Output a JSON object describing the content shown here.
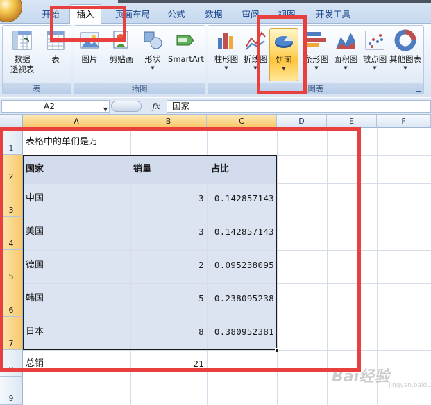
{
  "ribbon": {
    "tabs": [
      {
        "id": "home",
        "label": "开始"
      },
      {
        "id": "insert",
        "label": "插入",
        "active": true
      },
      {
        "id": "page-layout",
        "label": "页面布局"
      },
      {
        "id": "formulas",
        "label": "公式"
      },
      {
        "id": "data",
        "label": "数据"
      },
      {
        "id": "review",
        "label": "审阅"
      },
      {
        "id": "view",
        "label": "视图"
      },
      {
        "id": "developer",
        "label": "开发工具"
      }
    ],
    "groups": {
      "tables": {
        "label": "表",
        "pivot_label": "数据\n透视表",
        "table_label": "表"
      },
      "illustrations": {
        "label": "插图",
        "picture_label": "图片",
        "clipart_label": "剪贴画",
        "shapes_label": "形状",
        "smartart_label": "SmartArt"
      },
      "charts": {
        "label": "图表",
        "column_label": "柱形图",
        "line_label": "折线图",
        "pie_label": "饼图",
        "bar_label": "条形图",
        "area_label": "面积图",
        "scatter_label": "散点图",
        "other_label": "其他图表"
      }
    }
  },
  "formula_bar": {
    "name_box": "A2",
    "fx_label": "fx",
    "content": "国家"
  },
  "sheet": {
    "columns": [
      "A",
      "B",
      "C",
      "D",
      "E",
      "F"
    ],
    "rows": [
      "1",
      "2",
      "3",
      "4",
      "5",
      "6",
      "7",
      "8",
      "9"
    ],
    "title_cell": "表格中的单们是万",
    "table": {
      "headers": [
        "国家",
        "销量",
        "占比"
      ],
      "rows": [
        {
          "country": "中国",
          "sales": "3",
          "ratio": "0.142857143"
        },
        {
          "country": "美国",
          "sales": "3",
          "ratio": "0.142857143"
        },
        {
          "country": "德国",
          "sales": "2",
          "ratio": "0.095238095"
        },
        {
          "country": "韩国",
          "sales": "5",
          "ratio": "0.238095238"
        },
        {
          "country": "日本",
          "sales": "8",
          "ratio": "0.380952381"
        }
      ]
    },
    "total_label": "总销",
    "total_value": "21"
  },
  "watermark": {
    "main": "Bai经验",
    "sub": "jingyan.baidu.com"
  },
  "colors": {
    "annotation_red": "#e8403e",
    "selection_header": "#f8c86a",
    "table_fill": "#dde4f1",
    "ribbon_blue": "#15428b"
  }
}
